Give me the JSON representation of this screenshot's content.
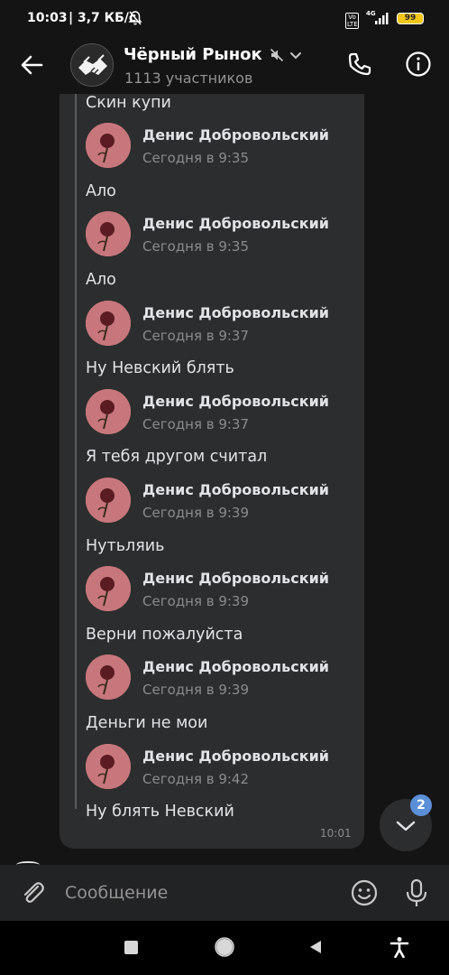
{
  "status_bar": {
    "time": "10:03",
    "speed": "| 3,7 КБ/с",
    "network_type": "4G",
    "volte": "Vo LTE",
    "battery": "99"
  },
  "header": {
    "title": "Чёрный Рынок",
    "subtitle": "1113 участников",
    "icons": [
      "back-arrow-icon",
      "mute-icon",
      "chevron-down-icon",
      "phone-icon",
      "info-icon"
    ]
  },
  "chat": {
    "first_text": "Скин купи",
    "forwarded": [
      {
        "author": "Денис Добровольский",
        "time": "Сегодня в 9:35",
        "text": "Ало"
      },
      {
        "author": "Денис Добровольский",
        "time": "Сегодня в 9:35",
        "text": "Ало"
      },
      {
        "author": "Денис Добровольский",
        "time": "Сегодня в 9:37",
        "text": "Ну Невский блять"
      },
      {
        "author": "Денис Добровольский",
        "time": "Сегодня в 9:37",
        "text": "Я тебя другом считал"
      },
      {
        "author": "Денис Добровольский",
        "time": "Сегодня в 9:39",
        "text": "Нутьляиь"
      },
      {
        "author": "Денис Добровольский",
        "time": "Сегодня в 9:39",
        "text": "Верни пожалуйста"
      },
      {
        "author": "Денис Добровольский",
        "time": "Сегодня в 9:39",
        "text": "Деньги не мои"
      },
      {
        "author": "Денис Добровольский",
        "time": "Сегодня в 9:42",
        "text": "Ну блять Невский"
      }
    ],
    "bubble_time": "10:01",
    "unread_badge": "2"
  },
  "composer": {
    "placeholder": "Сообщение"
  },
  "colors": {
    "background": "#141414",
    "bubble": "#2c2d2e",
    "badge": "#5b8fd8",
    "battery": "#f5c518"
  }
}
